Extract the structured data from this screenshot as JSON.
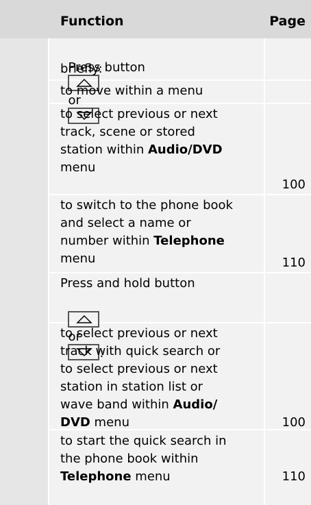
{
  "header": {
    "function_label": "Function",
    "page_label": "Page"
  },
  "rows": {
    "r1": {
      "line1_pre": "Press button",
      "line1_or": "or",
      "line2": "briefly:"
    },
    "r2": {
      "line1": "to move within a menu"
    },
    "r3": {
      "line1": "to select previous or next",
      "line2": "track, scene or stored",
      "line3_pre": "station within ",
      "line3_bold": "Audio/DVD",
      "line4": "menu",
      "page": "100"
    },
    "r4": {
      "line1": "to switch to the phone book",
      "line2": "and select a name or",
      "line3_pre": "number within ",
      "line3_bold": "Telephone",
      "line4": "menu",
      "page": "110"
    },
    "r5": {
      "line1": "Press and hold button",
      "line2_or": "or",
      "line2_post": ":"
    },
    "r6": {
      "line1": "to select previous or next",
      "line2": "track with quick search or",
      "line3": "to select previous or next",
      "line4": "station in station list or",
      "line5_pre": "wave band within ",
      "line5_bold": "Audio/",
      "line6_bold": "DVD",
      "line6_post": " menu",
      "page": "100"
    },
    "r7": {
      "line1": "to start the quick search in",
      "line2": "the phone book within",
      "line3_bold": "Telephone",
      "line3_post": " menu",
      "page": "110"
    }
  },
  "icons": {
    "up": "up-arrow-key-icon",
    "down": "down-arrow-key-icon"
  }
}
